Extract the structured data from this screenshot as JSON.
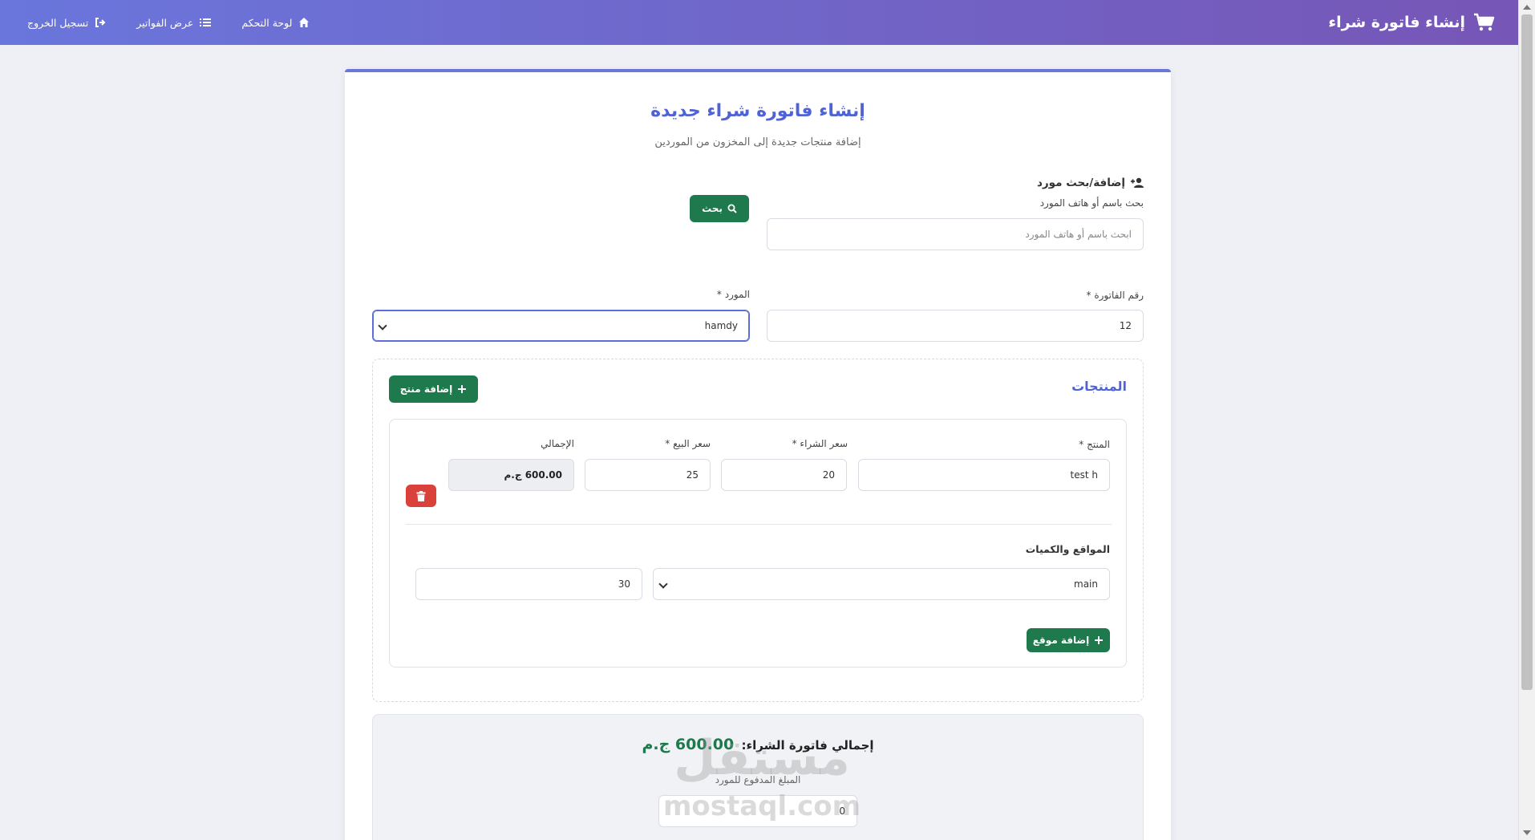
{
  "navbar": {
    "brand": "إنشاء فاتورة شراء",
    "links": [
      {
        "label": "لوحة التحكم",
        "icon": "home-icon"
      },
      {
        "label": "عرض الفواتير",
        "icon": "list-icon"
      },
      {
        "label": "تسجيل الخروج",
        "icon": "sign-out-icon"
      }
    ]
  },
  "page": {
    "title": "إنشاء فاتورة شراء جديدة",
    "subtitle": "إضافة منتجات جديدة إلى المخزون من الموردين"
  },
  "supplier_search": {
    "heading": "إضافة/بحث مورد",
    "label": "بحث باسم أو هاتف المورد",
    "placeholder": "ابحث باسم أو هاتف المورد",
    "button": "بحث"
  },
  "invoice": {
    "number_label": "رقم الفاتورة *",
    "number_value": "12",
    "supplier_label": "المورد *",
    "supplier_value": "hamdy"
  },
  "products": {
    "title": "المنتجات",
    "add_button": "إضافة منتج",
    "columns": {
      "product": "المنتج *",
      "purchase_price": "سعر الشراء *",
      "sale_price": "سعر البيع *",
      "total": "الإجمالي"
    },
    "items": [
      {
        "product": "test h",
        "purchase_price": "20",
        "sale_price": "25",
        "total": "600.00 ج.م",
        "locations_title": "المواقع والكميات",
        "location": "main",
        "quantity": "30",
        "add_location_button": "إضافة موقع"
      }
    ]
  },
  "summary": {
    "total_label": "إجمالي فاتورة الشراء:",
    "total_value": "600.00 ج.م",
    "paid_label": "المبلغ المدفوع للمورد",
    "paid_value": "0"
  },
  "watermark": {
    "arabic": "مستقل",
    "latin": "mostaql.com"
  },
  "colors": {
    "accent": "#4f63d8",
    "nav_gradient_start": "#6a76dc",
    "nav_gradient_end": "#7656b6",
    "success": "#1e7a4c",
    "danger": "#d9413a"
  }
}
